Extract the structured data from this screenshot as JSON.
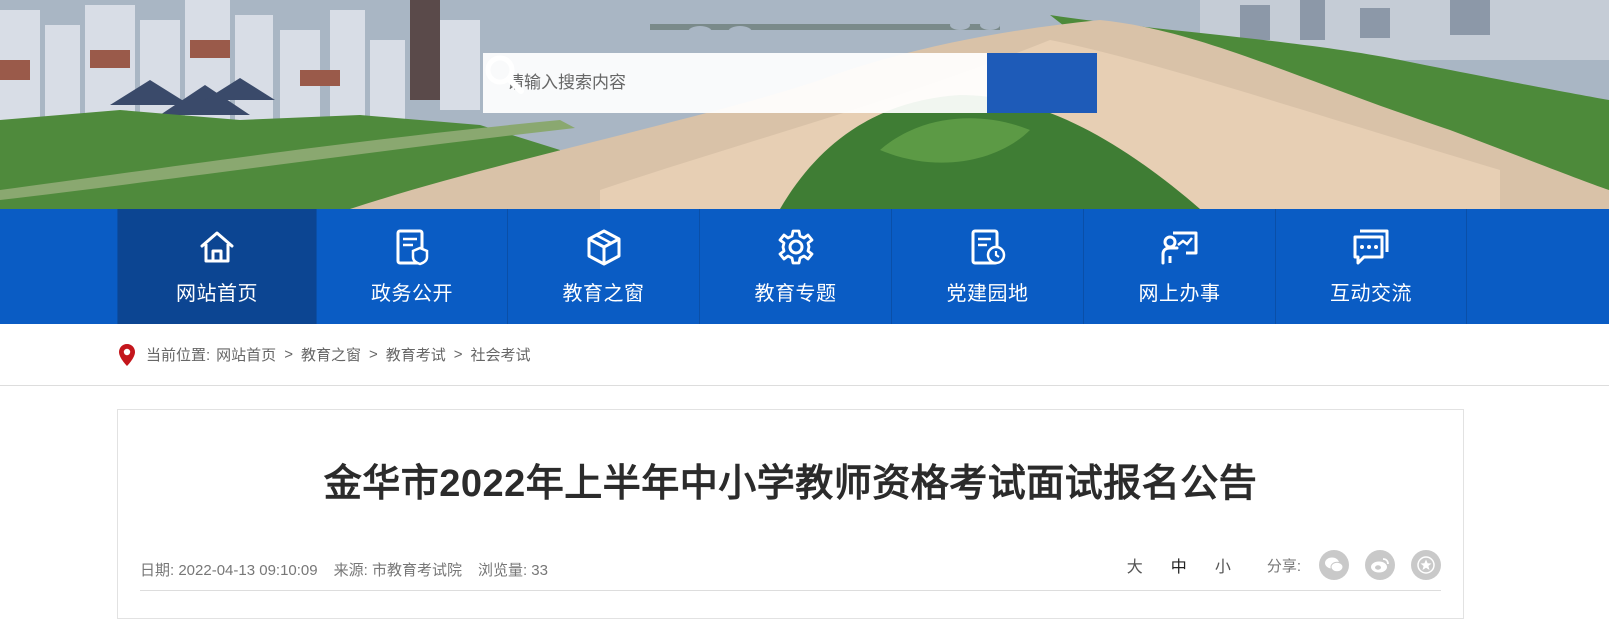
{
  "search": {
    "placeholder": "请输入搜索内容"
  },
  "nav": {
    "items": [
      {
        "label": "网站首页",
        "icon": "home-icon",
        "active": true
      },
      {
        "label": "政务公开",
        "icon": "document-shield-icon",
        "active": false
      },
      {
        "label": "教育之窗",
        "icon": "cube-icon",
        "active": false
      },
      {
        "label": "教育专题",
        "icon": "gear-icon",
        "active": false
      },
      {
        "label": "党建园地",
        "icon": "document-clock-icon",
        "active": false
      },
      {
        "label": "网上办事",
        "icon": "presenter-chart-icon",
        "active": false
      },
      {
        "label": "互动交流",
        "icon": "chat-bubble-icon",
        "active": false
      }
    ]
  },
  "breadcrumb": {
    "prefix": "当前位置:",
    "items": [
      "网站首页",
      "教育之窗",
      "教育考试",
      "社会考试"
    ],
    "separator": ">"
  },
  "article": {
    "title": "金华市2022年上半年中小学教师资格考试面试报名公告",
    "date": "日期: 2022-04-13 09:10:09",
    "source": "来源: 市教育考试院",
    "views": "浏览量: 33",
    "font_sizes": [
      "大",
      "中",
      "小"
    ],
    "share_label": "分享:",
    "share_icons": [
      "wechat-icon",
      "weibo-icon",
      "star-icon"
    ]
  },
  "colors": {
    "nav_bg": "#0a5cc4",
    "nav_active": "#0c4592",
    "search_button": "#1e5bb8",
    "pin_red": "#c4161c"
  }
}
